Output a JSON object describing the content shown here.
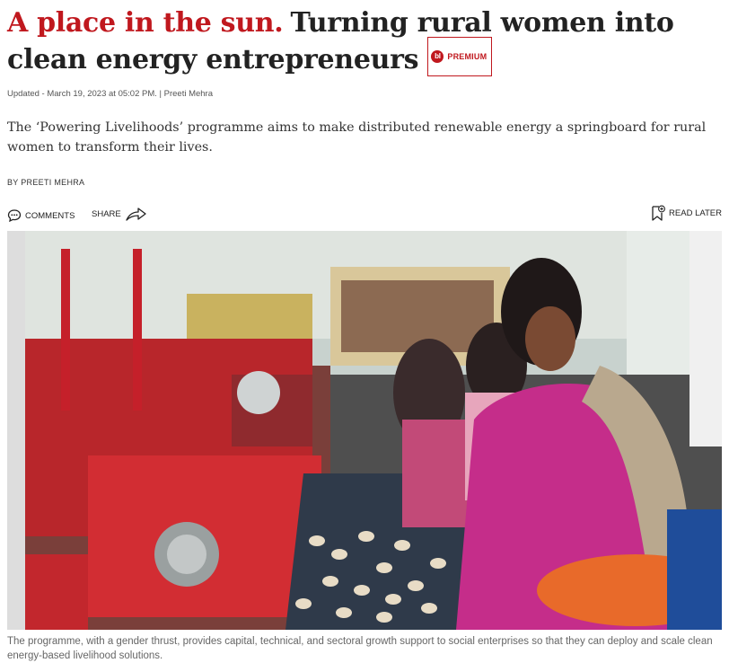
{
  "article": {
    "kicker": "A place in the sun.",
    "title": "Turning rural women into clean energy entrepreneurs",
    "premium_badge": "PREMIUM",
    "premium_icon_text": "bl",
    "updated": "Updated - March 19, 2023 at 05:02 PM. | Preeti Mehra",
    "summary": "The ‘Powering Livelihoods’ programme aims to make distributed renewable energy a springboard for rural women to transform their lives.",
    "byline": "BY PREETI MEHRA"
  },
  "actions": {
    "comments_label": "COMMENTS",
    "share_label": "SHARE",
    "read_later_label": "READ LATER"
  },
  "image": {
    "caption": "The programme, with a gender thrust, provides capital, technical, and sectoral growth support to social enterprises so that they can deploy and scale clean energy-based livelihood solutions."
  },
  "colors": {
    "brand_red": "#c0181e",
    "text": "#222222",
    "caption": "#666666"
  },
  "icons": [
    "comment-icon",
    "share-arrow-icon",
    "bookmark-add-icon",
    "premium-badge-icon"
  ]
}
